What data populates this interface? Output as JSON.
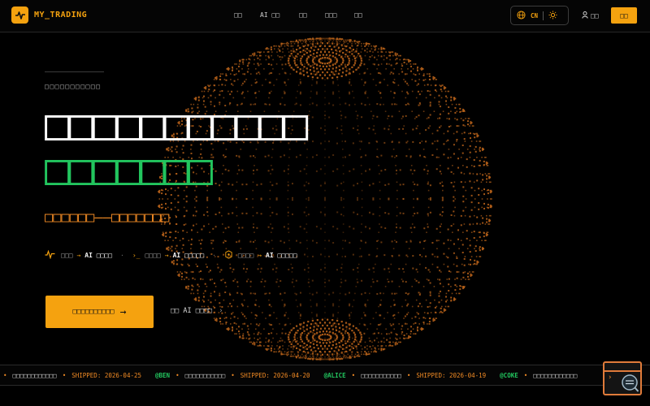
{
  "brand": {
    "name": "MY_TRADING"
  },
  "nav": {
    "items": [
      "□□",
      "AI □□",
      "□□",
      "□□□",
      "□□"
    ]
  },
  "header": {
    "lang": "CN",
    "login": "□□",
    "signup": "□□"
  },
  "hero": {
    "eyebrow": "□□□□□□□□□□□",
    "title_line1": "□□□□□□□□□□□",
    "title_line2": "□□□□□□□",
    "subtitle": "□□□□□□——□□□□□□□",
    "flow": [
      {
        "from": "□□□",
        "to": "AI □□□□"
      },
      {
        "from": "□□□□",
        "to": "AI □□□□□"
      },
      {
        "from": "□□□□",
        "to": "AI □□□□□"
      }
    ],
    "cta": "□□□□□□□□□□",
    "secondary": "□□ AI □□□□"
  },
  "ticker": [
    {
      "user": "",
      "text": "□□□□□□□□□□□□",
      "ship": "SHIPPED: 2026-04-25"
    },
    {
      "user": "@BEN",
      "text": "□□□□□□□□□□□",
      "ship": "SHIPPED: 2026-04-20"
    },
    {
      "user": "@ALICE",
      "text": "□□□□□□□□□□□",
      "ship": "SHIPPED: 2026-04-19"
    },
    {
      "user": "@COKE",
      "text": "□□□□□□□□□□□□",
      "ship": ""
    }
  ],
  "colors": {
    "accent": "#f5a20f",
    "success": "#22c55e",
    "subtitle": "#f08a24",
    "background": "#000000"
  },
  "icons": [
    "pulse-icon",
    "globe-icon",
    "sun-icon",
    "user-icon",
    "arrow-right-icon",
    "chevron-right-icon",
    "robot-icon"
  ]
}
